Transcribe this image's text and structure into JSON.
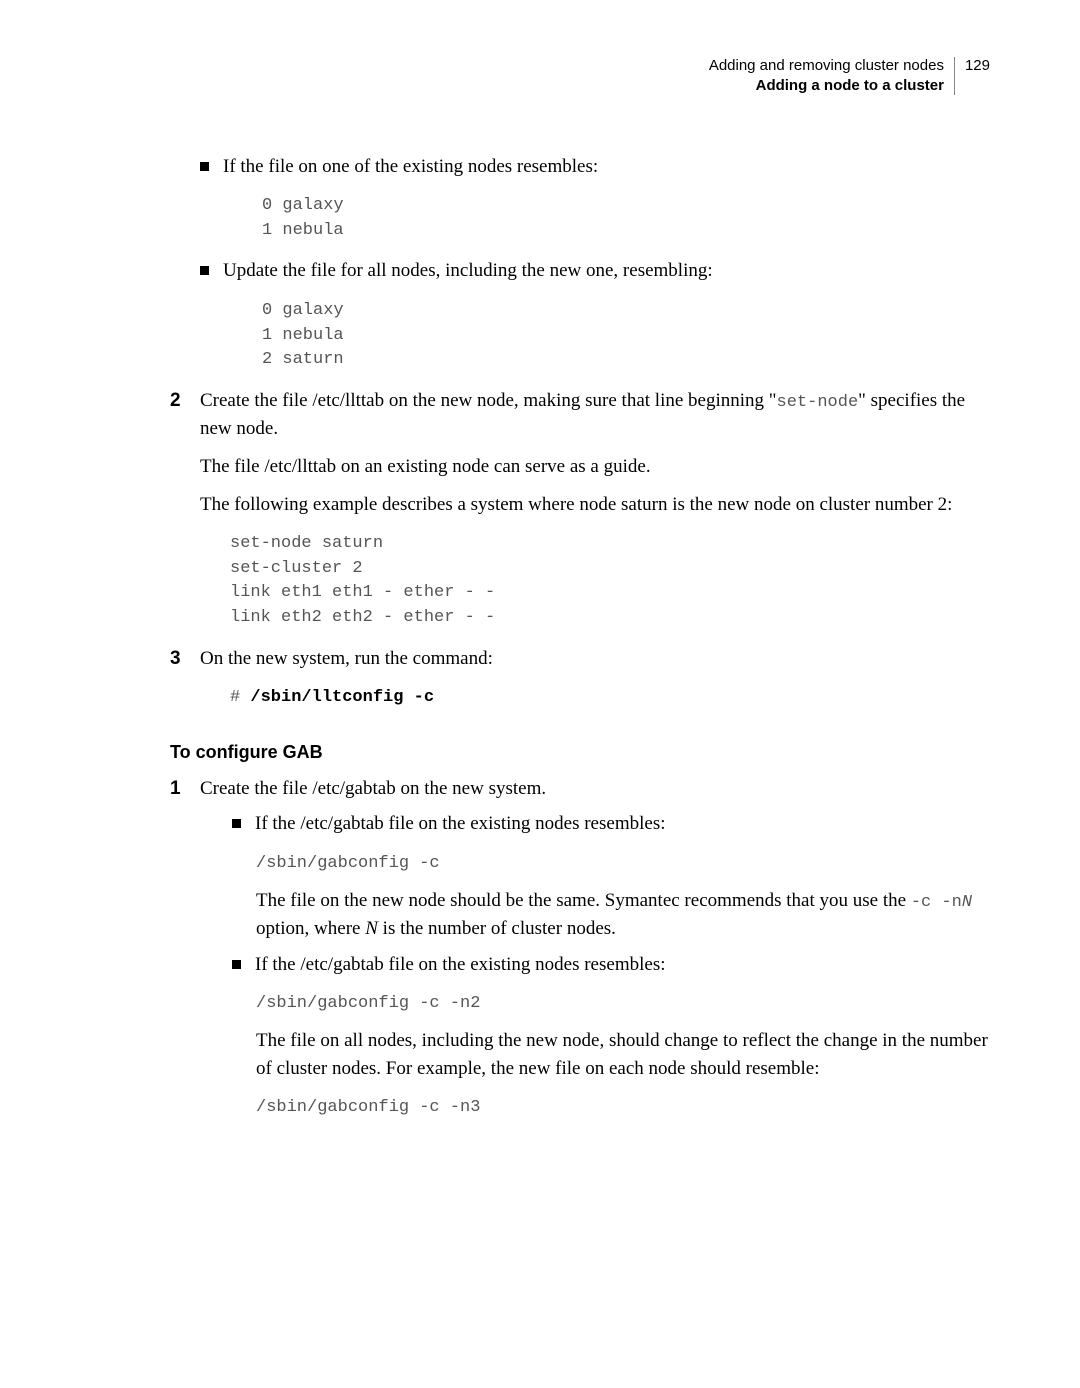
{
  "header": {
    "title_line": "Adding and removing cluster nodes",
    "section_line": "Adding a node to a cluster",
    "page_number": "129"
  },
  "bullet1": {
    "text": "If the file on one of the existing nodes resembles:",
    "code": "0 galaxy\n1 nebula"
  },
  "bullet2": {
    "text": "Update the file for all nodes, including the new one, resembling:",
    "code": "0 galaxy\n1 nebula\n2 saturn"
  },
  "step2": {
    "num": "2",
    "para1_pre": "Create the file /etc/llttab on the new node, making sure that line beginning \"",
    "para1_code": "set-node",
    "para1_post": "\" specifies the new node.",
    "para2": "The file /etc/llttab on an existing node can serve as a guide.",
    "para3": "The following example describes a system where node saturn is the new node on cluster number 2:",
    "code": "set-node saturn\nset-cluster 2\nlink eth1 eth1 - ether - -\nlink eth2 eth2 - ether - -"
  },
  "step3": {
    "num": "3",
    "text": "On the new system, run the command:",
    "prompt": "# ",
    "cmd": "/sbin/lltconfig -c"
  },
  "heading2": "To configure GAB",
  "step1b": {
    "num": "1",
    "text": "Create the file /etc/gabtab on the new system.",
    "sub1": {
      "text": "If the /etc/gabtab file on the existing nodes resembles:",
      "code": "/sbin/gabconfig -c",
      "para_pre": "The file on the new node should be the same. Symantec recommends that you use the ",
      "code_inline1": "-c -n",
      "code_inline2": "N ",
      "para_mid": "option, where ",
      "italic": "N",
      "para_post": " is the number of cluster nodes."
    },
    "sub2": {
      "text": "If the /etc/gabtab file on the existing nodes resembles:",
      "code": "/sbin/gabconfig -c -n2",
      "para": "The file on all nodes, including the new node, should change to reflect the change in the number of cluster nodes. For example, the new file on each node should resemble:",
      "code2": "/sbin/gabconfig -c -n3"
    }
  }
}
